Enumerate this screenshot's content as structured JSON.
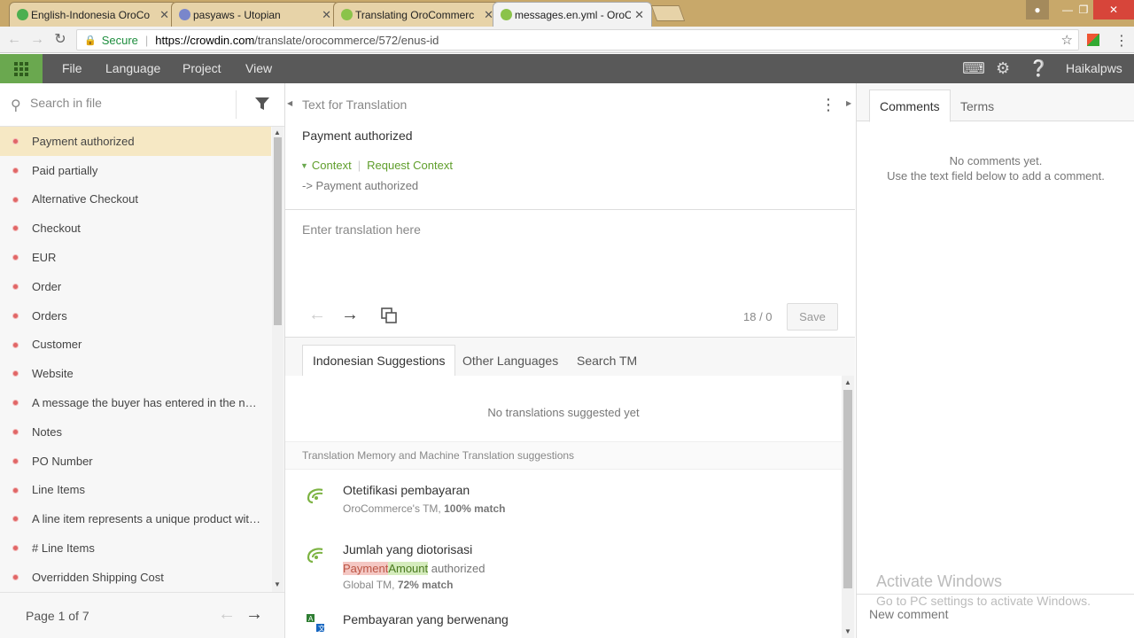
{
  "browser": {
    "tabs": [
      {
        "title": "English-Indonesia OroCo",
        "close": "✕",
        "color": "#4caf50"
      },
      {
        "title": "pasyaws - Utopian",
        "close": "✕",
        "color": "#7986cb"
      },
      {
        "title": "Translating OroCommerc",
        "close": "✕",
        "color": "#8bc34a"
      },
      {
        "title": "messages.en.yml - OroCo",
        "close": "✕",
        "color": "#8bc34a"
      }
    ],
    "secure_label": "Secure",
    "url_host": "https://crowdin.com",
    "url_path": "/translate/orocommerce/572/enus-id"
  },
  "appbar": {
    "menu": [
      "File",
      "Language",
      "Project",
      "View"
    ],
    "username": "Haikalpws"
  },
  "left": {
    "search_placeholder": "Search in file",
    "strings": [
      "Payment authorized",
      "Paid partially",
      "Alternative Checkout",
      "Checkout",
      "EUR",
      "Order",
      "Orders",
      "Customer",
      "Website",
      "A message the buyer has entered in the not…",
      "Notes",
      "PO Number",
      "Line Items",
      "A line item represents a unique product wit…",
      "# Line Items",
      "Overridden Shipping Cost"
    ],
    "pager": "Page 1 of 7"
  },
  "center": {
    "section_title": "Text for Translation",
    "source_text": "Payment authorized",
    "context_label": "Context",
    "request_context_label": "Request Context",
    "context_description": "-> Payment authorized",
    "translation_placeholder": "Enter translation here",
    "char_count": "18 / 0",
    "save_label": "Save",
    "tabs": [
      "Indonesian Suggestions",
      "Other Languages",
      "Search TM"
    ],
    "no_suggestions": "No translations suggested yet",
    "tm_header": "Translation Memory and Machine Translation suggestions",
    "tm_items": [
      {
        "text": "Otetifikasi pembayaran",
        "source_name": "OroCommerce's TM, ",
        "match": "100% match"
      },
      {
        "text": "Jumlah yang diotorisasi",
        "diff_del": "Payment",
        "diff_ins": "Amount",
        "diff_rest": " authorized",
        "source_name": "Global TM, ",
        "match": "72% match"
      },
      {
        "text": "Pembayaran yang berwenang"
      }
    ]
  },
  "right": {
    "tabs": [
      "Comments",
      "Terms"
    ],
    "no_comments_line1": "No comments yet.",
    "no_comments_line2": "Use the text field below to add a comment.",
    "new_comment_placeholder": "New comment",
    "watermark_title": "Activate Windows",
    "watermark_sub": "Go to PC settings to activate Windows."
  }
}
